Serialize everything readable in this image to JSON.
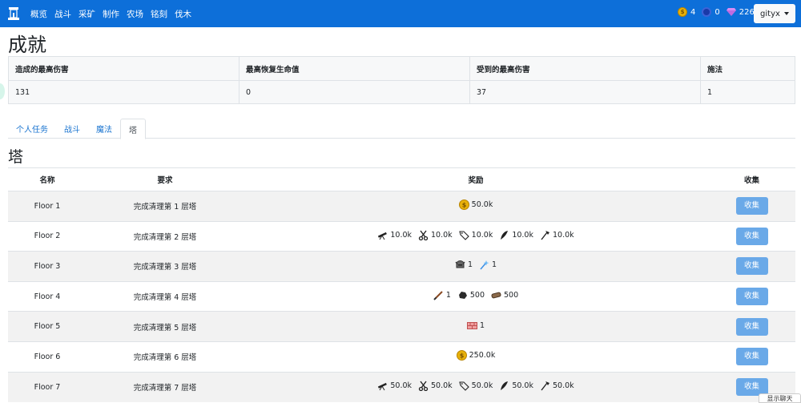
{
  "nav": {
    "links": [
      "概览",
      "战斗",
      "采矿",
      "制作",
      "农场",
      "铭刻",
      "伐木"
    ],
    "gold": "4",
    "dark_coin": "0",
    "gems": "226",
    "user": "gityx"
  },
  "page_title": "成就",
  "summary": {
    "headers": [
      "造成的最高伤害",
      "最高恢复生命值",
      "受到的最高伤害",
      "施法"
    ],
    "values": [
      "131",
      "0",
      "37",
      "1"
    ]
  },
  "tabs": [
    "个人任务",
    "战斗",
    "魔法",
    "塔"
  ],
  "section_title": "塔",
  "tower": {
    "headers": [
      "名称",
      "要求",
      "奖励",
      "收集"
    ],
    "rows": [
      {
        "name": "Floor 1",
        "req": "完成清理第 1 层塔",
        "rewards": [
          {
            "icon": "gold-coin-icon",
            "v": "50.0k"
          }
        ],
        "btn": "收集"
      },
      {
        "name": "Floor 2",
        "req": "完成清理第 2 层塔",
        "rewards": [
          {
            "icon": "telescope-icon",
            "v": "10.0k"
          },
          {
            "icon": "scissors-icon",
            "v": "10.0k"
          },
          {
            "icon": "tag-icon",
            "v": "10.0k"
          },
          {
            "icon": "feather-icon",
            "v": "10.0k"
          },
          {
            "icon": "axe-icon",
            "v": "10.0k"
          }
        ],
        "btn": "收集"
      },
      {
        "name": "Floor 3",
        "req": "完成清理第 3 层塔",
        "rewards": [
          {
            "icon": "helmet-icon",
            "v": "1"
          },
          {
            "icon": "wand-icon",
            "v": "1"
          }
        ],
        "btn": "收集"
      },
      {
        "name": "Floor 4",
        "req": "完成清理第 4 层塔",
        "rewards": [
          {
            "icon": "dagger-icon",
            "v": "1"
          },
          {
            "icon": "coal-icon",
            "v": "500"
          },
          {
            "icon": "log-icon",
            "v": "500"
          }
        ],
        "btn": "收集"
      },
      {
        "name": "Floor 5",
        "req": "完成清理第 5 层塔",
        "rewards": [
          {
            "icon": "brick-icon",
            "v": "1"
          }
        ],
        "btn": "收集"
      },
      {
        "name": "Floor 6",
        "req": "完成清理第 6 层塔",
        "rewards": [
          {
            "icon": "gold-coin-icon",
            "v": "250.0k"
          }
        ],
        "btn": "收集"
      },
      {
        "name": "Floor 7",
        "req": "完成清理第 7 层塔",
        "rewards": [
          {
            "icon": "telescope-icon",
            "v": "50.0k"
          },
          {
            "icon": "scissors-icon",
            "v": "50.0k"
          },
          {
            "icon": "tag-icon",
            "v": "50.0k"
          },
          {
            "icon": "feather-icon",
            "v": "50.0k"
          },
          {
            "icon": "axe-icon",
            "v": "50.0k"
          }
        ],
        "btn": "收集"
      }
    ]
  },
  "chat_tab": "显示聊天",
  "colors": {
    "navbar": "#0d6fd9",
    "button": "#6aa9e8",
    "gold": "#e8b10a"
  }
}
